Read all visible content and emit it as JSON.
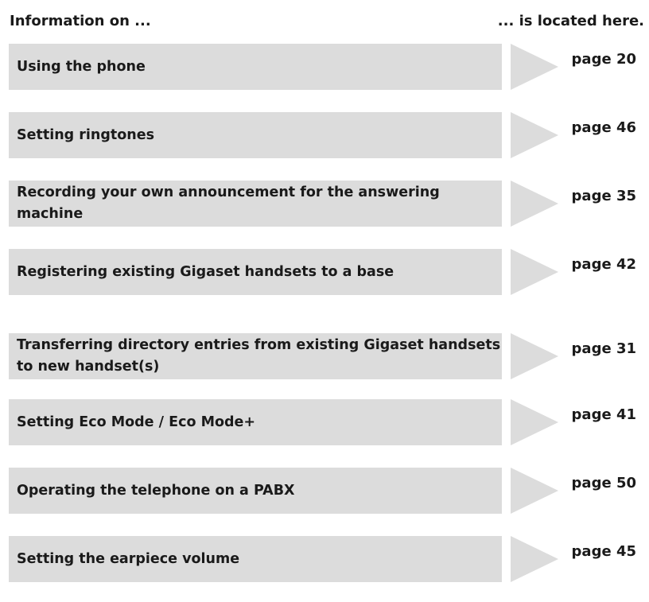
{
  "header": {
    "left": "Information on ...",
    "right": "... is located here."
  },
  "entries": [
    {
      "topic": "Using the phone",
      "page": "page 20"
    },
    {
      "topic": "Setting ringtones",
      "page": "page 46"
    },
    {
      "topic": "Recording your own announcement for the answering machine",
      "page": "page 35"
    },
    {
      "topic": "Registering existing Gigaset handsets to a base",
      "page": "page 42"
    },
    {
      "topic": "Transferring directory entries from existing Gigaset handsets to new handset(s)",
      "page": "page 31"
    },
    {
      "topic": "Setting Eco Mode / Eco Mode+",
      "page": "page 41"
    },
    {
      "topic": "Operating the telephone on a PABX",
      "page": "page 50"
    },
    {
      "topic": "Setting the earpiece volume",
      "page": "page 45"
    }
  ],
  "colors": {
    "box": "#dcdcdc",
    "text": "#1a1a1a"
  }
}
